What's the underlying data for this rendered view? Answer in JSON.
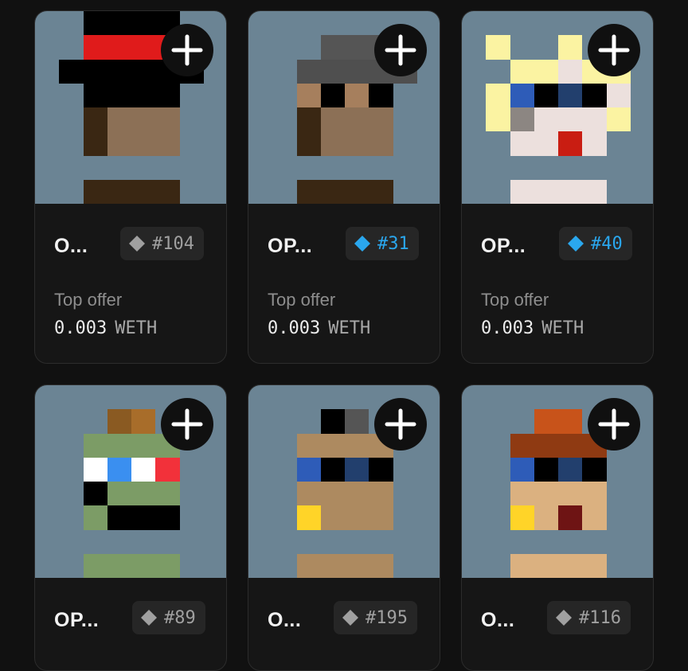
{
  "cards": [
    {
      "name": "O...",
      "token": "#104",
      "verified": false,
      "offer_label": "Top offer",
      "offer_amount": "0.003",
      "offer_currency": "WETH"
    },
    {
      "name": "OP...",
      "token": "#31",
      "verified": true,
      "offer_label": "Top offer",
      "offer_amount": "0.003",
      "offer_currency": "WETH"
    },
    {
      "name": "OP...",
      "token": "#40",
      "verified": true,
      "offer_label": "Top offer",
      "offer_amount": "0.003",
      "offer_currency": "WETH"
    },
    {
      "name": "OP...",
      "token": "#89",
      "verified": false
    },
    {
      "name": "O...",
      "token": "#195",
      "verified": false
    },
    {
      "name": "O...",
      "token": "#116",
      "verified": false
    }
  ],
  "colors": {
    "background": "#111111",
    "card": "#161616",
    "art_background": "#6b8494",
    "badge_blue": "#2aa7ee",
    "badge_gray": "#a0a0a0"
  },
  "icons": {
    "add": "plus-icon",
    "rarity": "diamond-icon"
  }
}
